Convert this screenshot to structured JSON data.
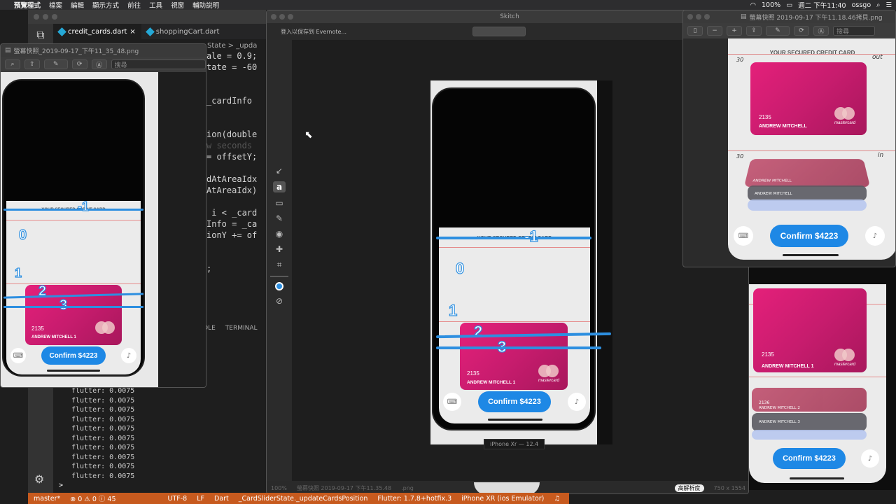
{
  "menubar": {
    "app": "預覽程式",
    "items": [
      "檔案",
      "編輯",
      "顯示方式",
      "前往",
      "工具",
      "視窗",
      "輔助說明"
    ],
    "battery": "100%",
    "clock": "週二 下午11:40",
    "user": "ossgo"
  },
  "vscode": {
    "tabs": [
      "credit_cards.dart",
      "shoppingCart.dart"
    ],
    "breadcrumb": "State > _upda",
    "code_lines": [
      "ale = 0.9;",
      "tate = -60",
      "",
      "",
      "_cardInfo",
      "",
      "",
      "ion(double",
      "w seconds",
      "= offsetY;",
      "",
      "dAtAreaIdx",
      "AtAreaIdx)",
      "",
      " i < _card",
      "Info = _ca",
      "ionY += of",
      "",
      "",
      ";"
    ],
    "panel_tabs": [
      "OLE",
      "TERMINAL"
    ],
    "terminal_lines": [
      "flutter: 0.0075",
      "flutter: 0.0075",
      "flutter: 0.0075",
      "flutter: 0.0075",
      "flutter: 0.0075",
      "flutter: 0.0075",
      "flutter: 0.0075",
      "flutter: 0.0075",
      "flutter: 0.0075",
      "flutter: 0.0075"
    ],
    "prompt": ">"
  },
  "statusbar": {
    "branch": "master*",
    "problems": "⊗ 0 ⚠ 0 ⓘ 45",
    "encoding": "UTF-8",
    "eol": "LF",
    "language": "Dart",
    "symbol": "_CardSliderState._updateCardsPosition",
    "flutter": "Flutter: 1.7.8+hotfix.3",
    "device": "iPhone XR (ios Emulator)"
  },
  "preview_left": {
    "title": "螢幕快照_2019-09-17_下午11_35_48.png",
    "search_placeholder": "搜尋",
    "device_label": "iPhone Xr"
  },
  "skitch": {
    "title": "Skitch",
    "evernote": "登入以保存到 Evernote...",
    "filename": "螢幕快照 2019-09-17 下午11.35.48",
    "ext": ".png",
    "zoom": "100%",
    "hd": "高解析度",
    "dims": "750 x 1554",
    "device_label": "iPhone Xr — 12.4"
  },
  "preview_right": {
    "title": "螢幕快照 2019-09-17 下午11.18.46拷貝.png",
    "search_placeholder": "搜尋",
    "out_label": "out",
    "in_label": "in",
    "margin_label": "30"
  },
  "app": {
    "header": "YOUR SECURED CREDIT CARD",
    "card_number": "2135",
    "card_number_alt": "2136",
    "card_name": "ANDREW MITCHELL",
    "card_name_1": "ANDREW MITCHELL 1",
    "card_name_2": "ANDREW MITCHELL 2",
    "card_name_3": "ANDREW MITCHELL 3",
    "mastercard": "mastercard",
    "confirm": "Confirm $4223"
  },
  "annotations": [
    "0",
    "1",
    "2",
    "3",
    "-1"
  ],
  "colors": {
    "accent_blue": "#1e88e5",
    "card_pink": "#e4207a",
    "statusbar_orange": "#c75a1e",
    "annotation_blue": "#2d8fe0"
  }
}
